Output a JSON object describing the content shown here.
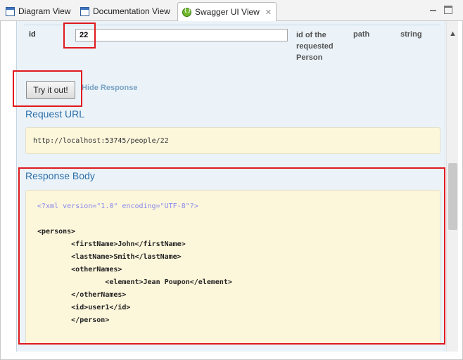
{
  "tabs": [
    {
      "label": "Diagram View",
      "icon": "view-icon",
      "active": false
    },
    {
      "label": "Documentation View",
      "icon": "view-icon",
      "active": false
    },
    {
      "label": "Swagger UI View",
      "icon": "swagger-icon",
      "active": true,
      "close": "✕"
    }
  ],
  "parameter": {
    "name": "id",
    "value": "22",
    "description": "id of the requested Person",
    "param_type": "path",
    "data_type": "string"
  },
  "actions": {
    "try_label": "Try it out!",
    "hide_label": "Hide Response"
  },
  "request_url": {
    "title": "Request URL",
    "value": "http://localhost:53745/people/22"
  },
  "response_body": {
    "title": "Response Body",
    "lines": [
      {
        "text": "<?xml version=\"1.0\" encoding=\"UTF-8\"?>",
        "kind": "decl"
      },
      {
        "text": "",
        "kind": "gap"
      },
      {
        "text": "<persons>",
        "kind": "tag"
      },
      {
        "text": "        <firstName>John</firstName>",
        "kind": "tag"
      },
      {
        "text": "        <lastName>Smith</lastName>",
        "kind": "tag"
      },
      {
        "text": "        <otherNames>",
        "kind": "tag"
      },
      {
        "text": "                <element>Jean Poupon</element>",
        "kind": "tag"
      },
      {
        "text": "        </otherNames>",
        "kind": "tag"
      },
      {
        "text": "        <id>user1</id>",
        "kind": "tag"
      },
      {
        "text": "        </person>",
        "kind": "tag"
      }
    ]
  },
  "colors": {
    "panel_bg": "#ebf3f9",
    "code_bg": "#fcf6db",
    "title_blue": "#2c6fa8",
    "highlight_red": "#e0191e"
  }
}
